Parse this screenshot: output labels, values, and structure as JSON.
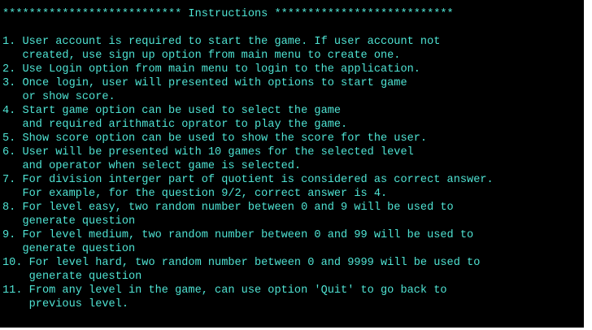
{
  "console": {
    "lines": [
      "*************************** Instructions ***************************",
      "",
      "1. User account is required to start the game. If user account not",
      "   created, use sign up option from main menu to create one.",
      "2. Use Login option from main menu to login to the application.",
      "3. Once login, user will presented with options to start game",
      "   or show score.",
      "4. Start game option can be used to select the game",
      "   and required arithmatic oprator to play the game.",
      "5. Show score option can be used to show the score for the user.",
      "6. User will be presented with 10 games for the selected level",
      "   and operator when select game is selected.",
      "7. For division interger part of quotient is considered as correct answer.",
      "   For example, for the question 9/2, correct answer is 4.",
      "8. For level easy, two random number between 0 and 9 will be used to",
      "   generate question",
      "9. For level medium, two random number between 0 and 99 will be used to",
      "   generate question",
      "10. For level hard, two random number between 0 and 9999 will be used to",
      "    generate question",
      "11. From any level in the game, can use option 'Quit' to go back to",
      "    previous level."
    ]
  },
  "colors": {
    "background": "#000000",
    "text": "#4fe3d3"
  }
}
